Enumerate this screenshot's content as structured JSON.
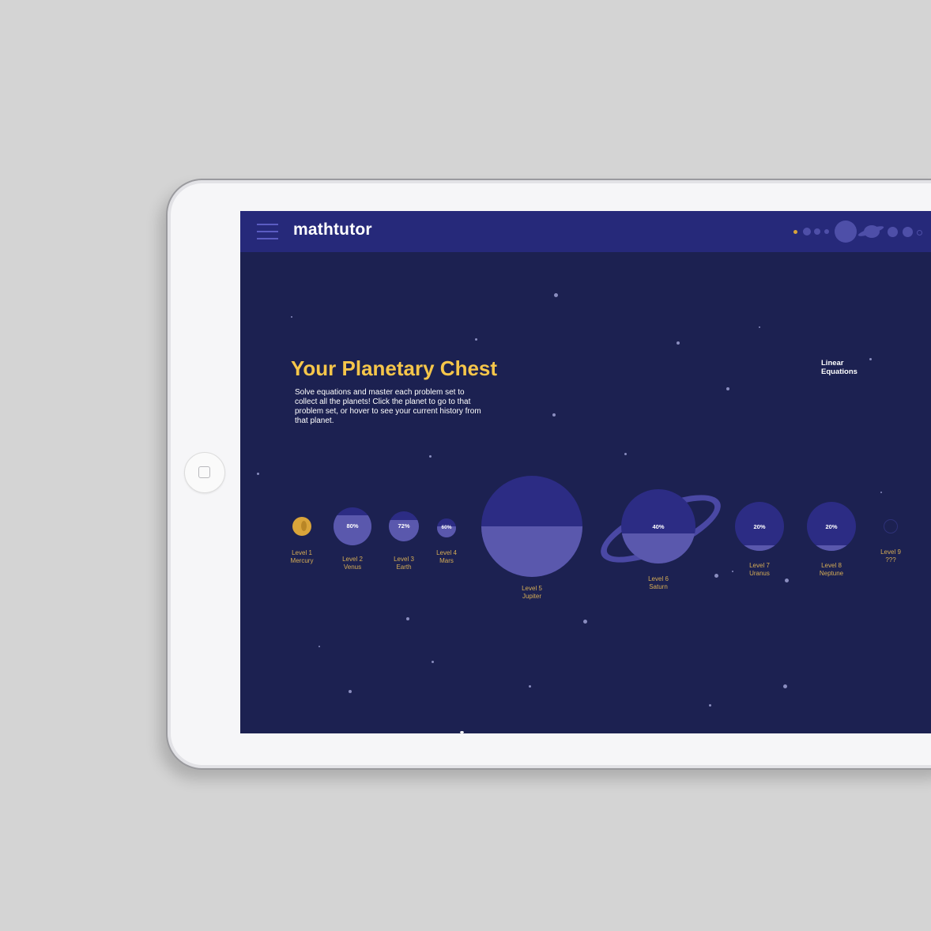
{
  "app": {
    "brand": "mathtutor",
    "menu_icon": "hamburger-menu-icon"
  },
  "colors": {
    "background": "#d4d4d4",
    "screen": "#1c2151",
    "topbar": "#26297a",
    "title": "#f6c64a",
    "label": "#d6ad55",
    "planet_dark": "#2c2c84",
    "planet_fill": "#5a58ad",
    "mercury": "#d9a43a"
  },
  "hero": {
    "title": "Your Planetary Chest",
    "description": "Solve equations and master each problem set to collect all the planets! Click the planet to go to that problem set, or hover to see your current history from that planet."
  },
  "topic": {
    "label": "Linear Equations"
  },
  "planets": [
    {
      "level": "Level 1",
      "name": "Mercury",
      "progress": 1.0,
      "percent_label": ""
    },
    {
      "level": "Level 2",
      "name": "Venus",
      "progress": 0.8,
      "percent_label": "80%"
    },
    {
      "level": "Level 3",
      "name": "Earth",
      "progress": 0.72,
      "percent_label": "72%"
    },
    {
      "level": "Level 4",
      "name": "Mars",
      "progress": 0.6,
      "percent_label": "60%"
    },
    {
      "level": "Level 5",
      "name": "Jupiter",
      "progress": 0.5,
      "percent_label": ""
    },
    {
      "level": "Level 6",
      "name": "Saturn",
      "progress": 0.4,
      "percent_label": "40%"
    },
    {
      "level": "Level 7",
      "name": "Uranus",
      "progress": 0.2,
      "percent_label": "20%"
    },
    {
      "level": "Level 8",
      "name": "Neptune",
      "progress": 0.2,
      "percent_label": "20%"
    },
    {
      "level": "Level 9",
      "name": "???",
      "progress": 0,
      "percent_label": ""
    }
  ]
}
